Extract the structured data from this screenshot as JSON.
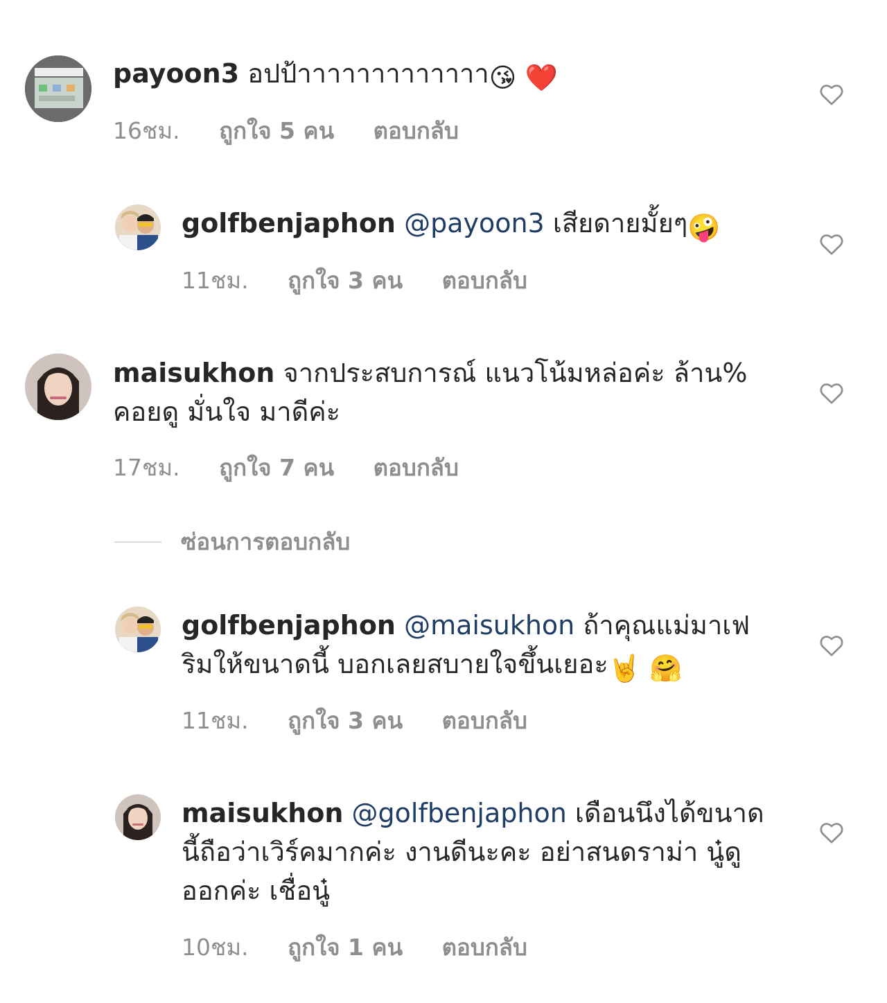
{
  "comments": [
    {
      "username": "payoon3",
      "mention": "",
      "text": "อปป้าาาาาาาาาาาาา",
      "emoji1": "😘",
      "emoji2": "❤️",
      "time": "16ชม.",
      "likes": "ถูกใจ 5 คน",
      "reply": "ตอบกลับ"
    },
    {
      "username": "golfbenjaphon",
      "mention": "@payoon3",
      "text": "เสียดายมั้ยๆ",
      "emoji1": "🤪",
      "time": "11ชม.",
      "likes": "ถูกใจ 3 คน",
      "reply": "ตอบกลับ"
    },
    {
      "username": "maisukhon",
      "mention": "",
      "text": "จากประสบการณ์ แนวโน้มหล่อค่ะ ล้าน% คอยดู มั่นใจ มาดีค่ะ",
      "time": "17ชม.",
      "likes": "ถูกใจ 7 คน",
      "reply": "ตอบกลับ"
    },
    {
      "username": "golfbenjaphon",
      "mention": "@maisukhon",
      "text": "ถ้าคุณแม่มาเฟริมให้ขนาดนี้ บอกเลยสบายใจขึ้นเยอะ",
      "emoji1": "🤘",
      "emoji2": "🤗",
      "time": "11ชม.",
      "likes": "ถูกใจ 3 คน",
      "reply": "ตอบกลับ"
    },
    {
      "username": "maisukhon",
      "mention": "@golfbenjaphon",
      "text": "เดือนนึงได้ขนาดนี้ถือว่าเวิร์คมากค่ะ งานดีนะคะ อย่าสนดราม่า นู๋ดูออกค่ะ เชื่อนู๋",
      "time": "10ชม.",
      "likes": "ถูกใจ 1 คน",
      "reply": "ตอบกลับ"
    }
  ],
  "hide_replies": "ซ่อนการตอบกลับ",
  "colors": {
    "text": "#262626",
    "meta": "#8e8e8e",
    "mention": "#1e3c64",
    "heart": "#8e8e8e"
  }
}
